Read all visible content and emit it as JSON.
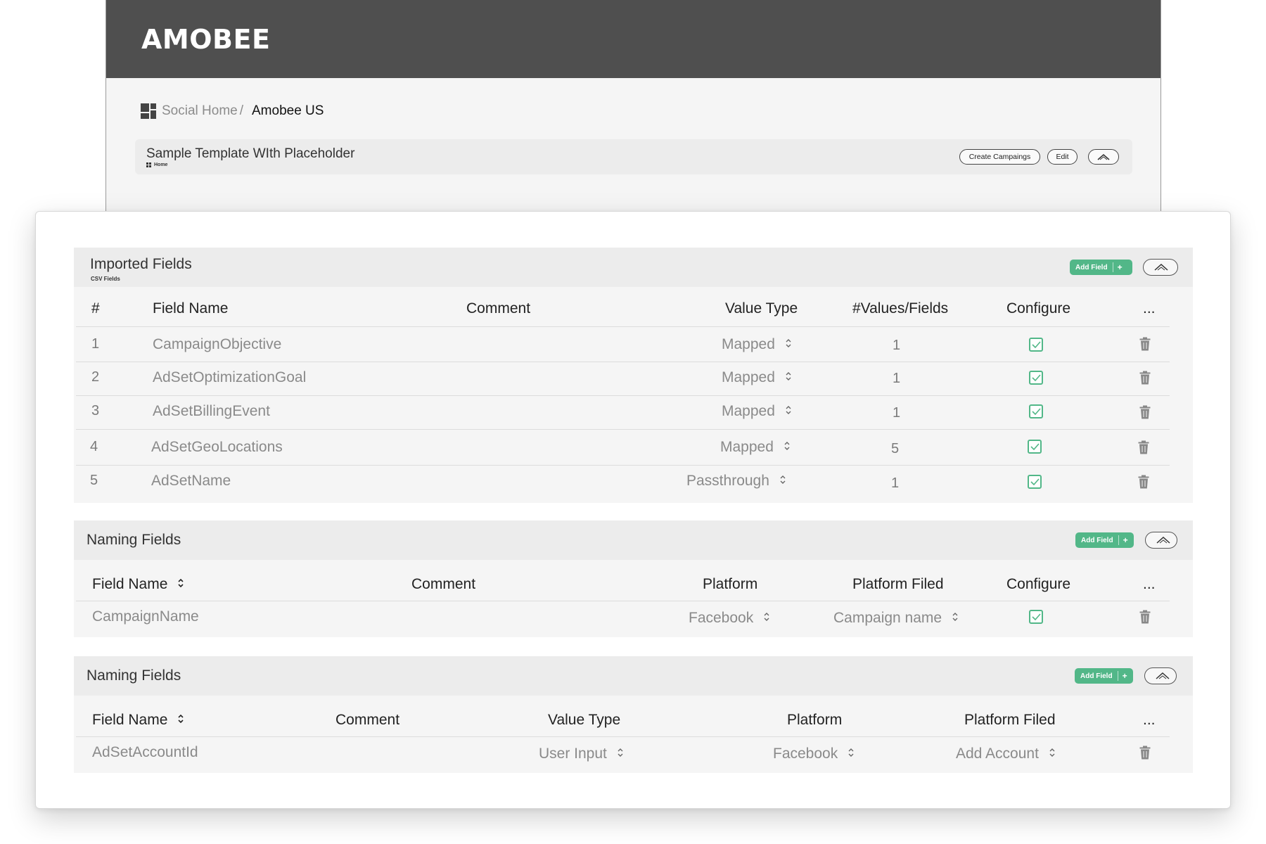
{
  "app": {
    "logo": "AMOBEE"
  },
  "breadcrumb": {
    "home": "Social Home",
    "separator": "/",
    "current": "Amobee US"
  },
  "template": {
    "title": "Sample Template WIth Placeholder",
    "sub": "Home",
    "create_campaigns_label": "Create Campaings",
    "edit_label": "Edit"
  },
  "imported": {
    "title": "Imported Fields",
    "subtitle": "CSV Fields",
    "add_field_label": "Add Field",
    "add_plus": "+",
    "headers": {
      "num": "#",
      "field_name": "Field Name",
      "comment": "Comment",
      "value_type": "Value Type",
      "values_fields": "#Values/Fields",
      "configure": "Configure",
      "more": "..."
    },
    "rows": [
      {
        "num": "1",
        "field": "CampaignObjective",
        "value_type": "Mapped",
        "count": "1"
      },
      {
        "num": "2",
        "field": "AdSetOptimizationGoal",
        "value_type": "Mapped",
        "count": "1"
      },
      {
        "num": "3",
        "field": "AdSetBillingEvent",
        "value_type": "Mapped",
        "count": "1"
      },
      {
        "num": "4",
        "field": "AdSetGeoLocations",
        "value_type": "Mapped",
        "count": "5"
      },
      {
        "num": "5",
        "field": "AdSetName",
        "value_type": "Passthrough",
        "count": "1"
      }
    ]
  },
  "naming1": {
    "title": "Naming Fields",
    "add_field_label": "Add Field",
    "add_plus": "+",
    "headers": {
      "field_name": "Field Name",
      "comment": "Comment",
      "platform": "Platform",
      "platform_filed": "Platform Filed",
      "configure": "Configure",
      "more": "..."
    },
    "row": {
      "field": "CampaignName",
      "platform": "Facebook",
      "platform_filed": "Campaign name"
    }
  },
  "naming2": {
    "title": "Naming Fields",
    "add_field_label": "Add Field",
    "add_plus": "+",
    "headers": {
      "field_name": "Field Name",
      "comment": "Comment",
      "value_type": "Value Type",
      "platform": "Platform",
      "platform_filed": "Platform Filed",
      "more": "..."
    },
    "row": {
      "field": "AdSetAccountId",
      "value_type": "User Input",
      "platform": "Facebook",
      "platform_filed": "Add Account"
    }
  },
  "icons": {
    "breadcrumb": "dashboard-grid-icon",
    "collapse": "chevron-up-icon",
    "sort": "sort-updown-icon",
    "check": "checkbox-checked-icon",
    "delete": "trash-icon"
  },
  "colors": {
    "topbar": "#4f4f4f",
    "accent_green": "#52b788",
    "section_header": "#ececec",
    "section_body": "#f5f5f5"
  }
}
